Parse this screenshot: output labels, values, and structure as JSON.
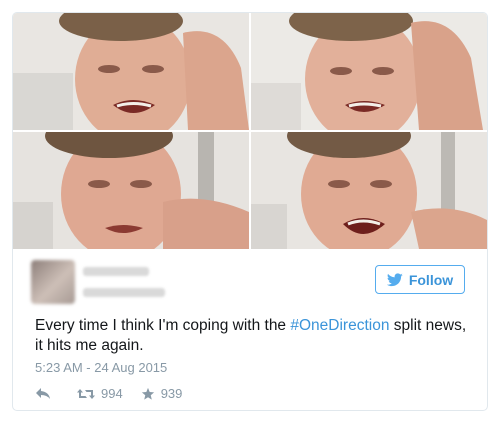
{
  "tweet": {
    "text_before": "Every time I think I'm coping with the ",
    "hashtag": "#OneDirection",
    "text_after": " split news, it hits me again.",
    "timestamp": "5:23 AM - 24 Aug 2015",
    "follow_label": "Follow",
    "retweets": "994",
    "favorites": "939"
  },
  "icons": {
    "follow": "twitter-bird-icon",
    "reply": "reply-icon",
    "retweet": "retweet-icon",
    "favorite": "star-icon"
  },
  "colors": {
    "accent": "#55acee",
    "link": "#3b94d9",
    "muted": "#8899a6",
    "text": "#14171a"
  }
}
